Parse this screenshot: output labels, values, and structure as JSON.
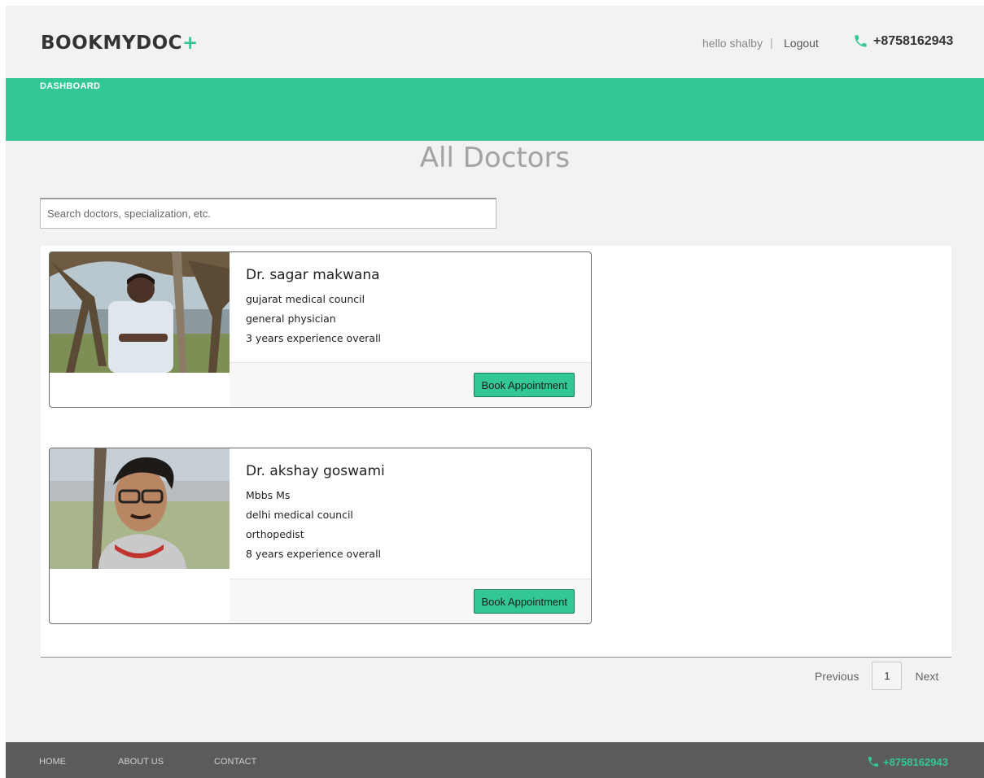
{
  "header": {
    "brand": "BOOKMYDOC",
    "brand_plus": "+",
    "greeting": "hello shalby",
    "separator": "|",
    "logout_label": "Logout",
    "phone": "+8758162943",
    "accent_color": "#34c796"
  },
  "nav": {
    "dashboard_label": "DASHBOARD"
  },
  "page": {
    "title": "All Doctors"
  },
  "search": {
    "placeholder": "Search doctors, specialization, etc.",
    "value": ""
  },
  "doctors": [
    {
      "name": "Dr. sagar makwana",
      "details": [
        "gujarat medical council",
        "general physician",
        "3 years experience overall"
      ],
      "book_label": "Book Appointment"
    },
    {
      "name": "Dr. akshay goswami",
      "details": [
        "Mbbs Ms",
        "delhi medical council",
        "orthopedist",
        "8 years experience overall"
      ],
      "book_label": "Book Appointment"
    }
  ],
  "pagination": {
    "previous_label": "Previous",
    "current_page": "1",
    "next_label": "Next"
  },
  "footer": {
    "links": [
      "HOME",
      "ABOUT US",
      "CONTACT"
    ],
    "phone": "+8758162943"
  }
}
